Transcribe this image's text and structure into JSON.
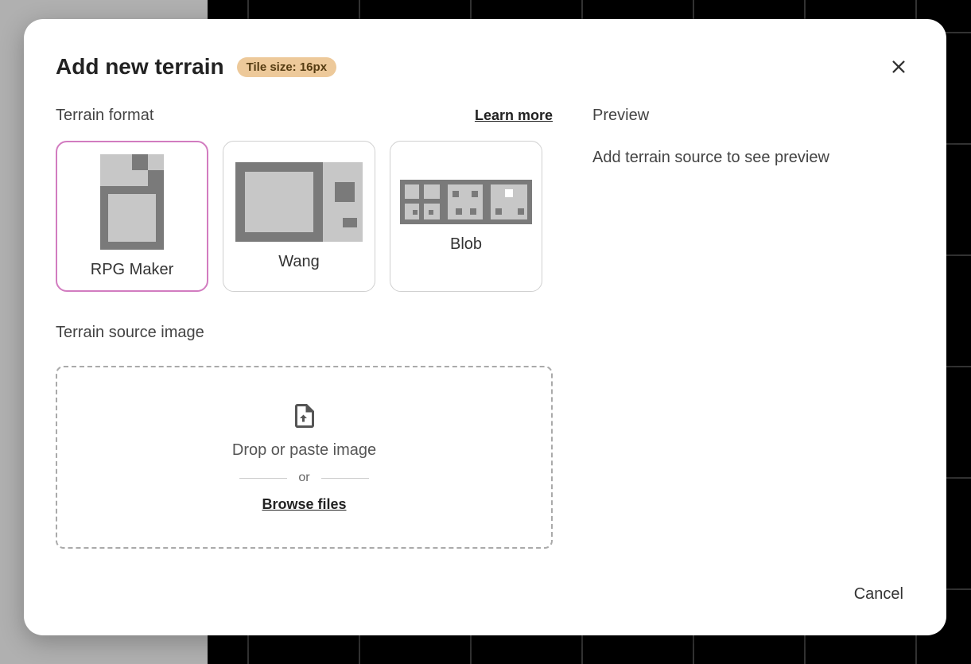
{
  "header": {
    "title": "Add new terrain",
    "badge": "Tile size: 16px"
  },
  "format": {
    "label": "Terrain format",
    "learn_more": "Learn more",
    "options": [
      {
        "name": "RPG Maker",
        "selected": true
      },
      {
        "name": "Wang",
        "selected": false
      },
      {
        "name": "Blob",
        "selected": false
      }
    ]
  },
  "source": {
    "label": "Terrain source image",
    "drop_text": "Drop or paste image",
    "or_text": "or",
    "browse": "Browse files"
  },
  "preview": {
    "label": "Preview",
    "empty_text": "Add terrain source to see preview"
  },
  "footer": {
    "cancel": "Cancel"
  }
}
